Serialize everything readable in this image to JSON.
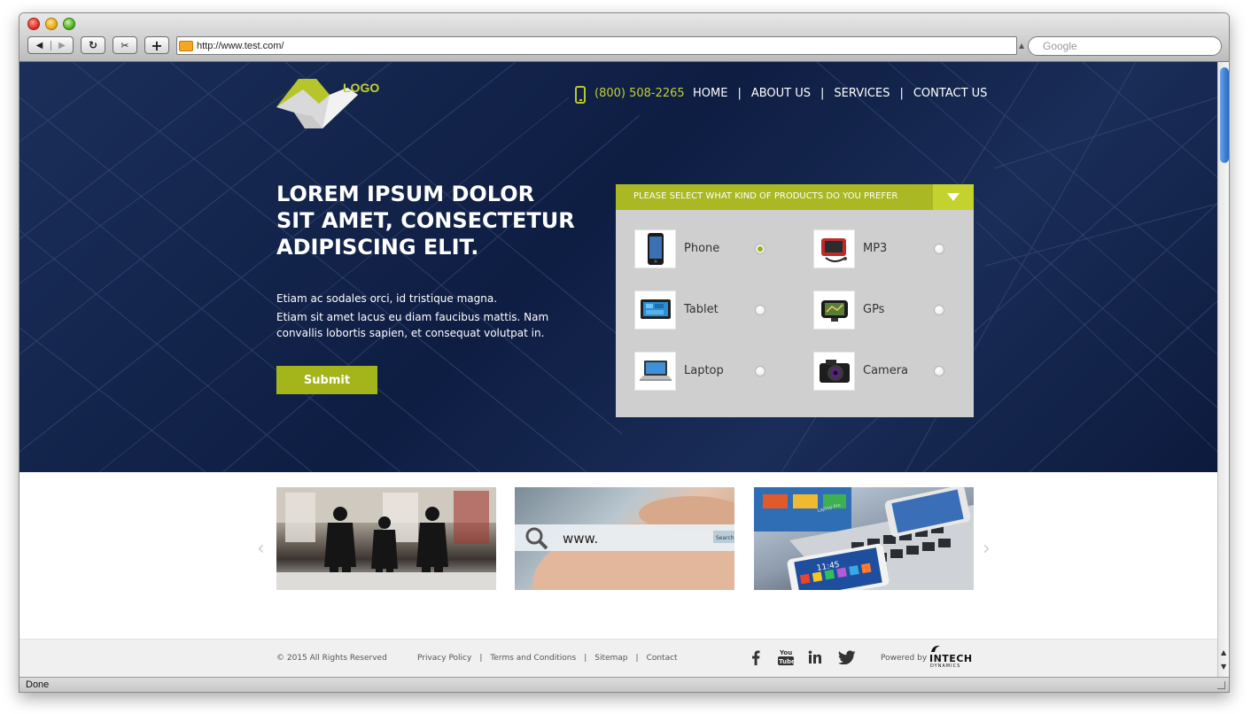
{
  "browser": {
    "url": "http://www.test.com/",
    "search_placeholder": "Google",
    "status": "Done"
  },
  "header": {
    "logo_text": "LOGO",
    "phone": "(800) 508-2265",
    "nav": [
      "HOME",
      "ABOUT US",
      "SERVICES",
      "CONTACT US"
    ]
  },
  "hero": {
    "headline": "LOREM IPSUM DOLOR SIT AMET, CONSECTETUR ADIPISCING ELIT.",
    "line1": "Etiam ac sodales orci, id tristique magna.",
    "line2": "Etiam sit amet lacus eu diam faucibus mattis. Nam convallis lobortis sapien, et consequat volutpat in.",
    "submit_label": "Submit"
  },
  "product_panel": {
    "title": "PLEASE SELECT WHAT KIND OF PRODUCTS DO YOU PREFER",
    "options": [
      {
        "label": "Phone",
        "selected": true
      },
      {
        "label": "MP3",
        "selected": false
      },
      {
        "label": "Tablet",
        "selected": false
      },
      {
        "label": "GPs",
        "selected": false
      },
      {
        "label": "Laptop",
        "selected": false
      },
      {
        "label": "Camera",
        "selected": false
      }
    ]
  },
  "carousel": {
    "prev": "‹",
    "next": "›",
    "search_overlay": "www.",
    "search_button": "Search",
    "laptop_brand": "Laptop Pro",
    "phone_time": "11:45"
  },
  "footer": {
    "copyright": "© 2015 All Rights Reserved",
    "links": [
      "Privacy Policy",
      "Terms and Conditions",
      "Sitemap",
      "Contact"
    ],
    "social": [
      "facebook-icon",
      "youtube-icon",
      "linkedin-icon",
      "twitter-icon"
    ],
    "powered": "Powered  by",
    "brand_name": "INTECH",
    "brand_sub": "DYNAMICS"
  },
  "colors": {
    "accent": "#a9b823",
    "hero_bg": "#12224a",
    "panel_bg": "#cfcfcf"
  }
}
